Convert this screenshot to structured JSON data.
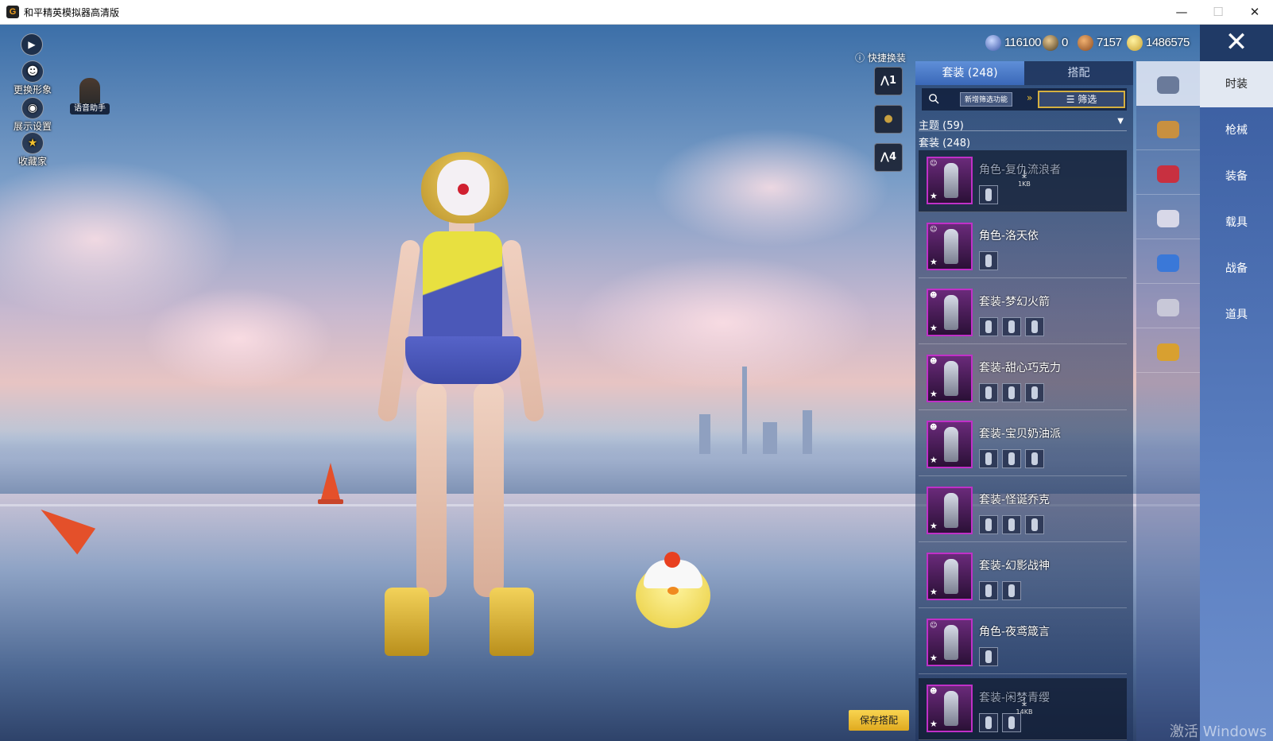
{
  "window": {
    "title": "和平精英模拟器高清版",
    "app_icon_letter": "G",
    "minimize": "—",
    "maximize": "☐",
    "close": "✕"
  },
  "left_toolbar": {
    "change_avatar": "更换形象",
    "display_settings": "展示设置",
    "collector": "收藏家",
    "voice_assistant": "语音助手"
  },
  "currencies": [
    {
      "icon": "blue-coin-icon",
      "value": "116100"
    },
    {
      "icon": "token-icon",
      "value": "0"
    },
    {
      "icon": "bronze-coin-icon",
      "value": "7157"
    },
    {
      "icon": "gold-coin-icon",
      "value": "1486575"
    }
  ],
  "quick_change": {
    "label": "快捷换装",
    "slots": [
      "1",
      "",
      "4"
    ]
  },
  "panel": {
    "tabs": {
      "suits": "套装 (248)",
      "match": "搭配"
    },
    "new_filter": "新增筛选功能",
    "filter": "筛选",
    "theme": "主题 (59)",
    "suits_count": "套装 (248)",
    "items": [
      {
        "name": "角色-复仇流浪者",
        "parts": 1,
        "dim": true,
        "download": "1KB",
        "badge": "role"
      },
      {
        "name": "角色-洛天依",
        "parts": 1,
        "dim": false,
        "download": "",
        "badge": "role"
      },
      {
        "name": "套装-梦幻火箭",
        "parts": 3,
        "dim": false,
        "download": "",
        "badge": "suit"
      },
      {
        "name": "套装-甜心巧克力",
        "parts": 3,
        "dim": false,
        "download": "",
        "badge": "suit"
      },
      {
        "name": "套装-宝贝奶油派",
        "parts": 3,
        "dim": false,
        "download": "",
        "badge": "suit"
      },
      {
        "name": "套装-怪诞乔克",
        "parts": 3,
        "dim": false,
        "download": "",
        "badge": ""
      },
      {
        "name": "套装-幻影战神",
        "parts": 2,
        "dim": false,
        "download": "",
        "badge": ""
      },
      {
        "name": "角色-夜鸢箴言",
        "parts": 1,
        "dim": false,
        "download": "",
        "badge": "role"
      },
      {
        "name": "套装-闲梦青缨",
        "parts": 2,
        "dim": true,
        "download": "14KB",
        "badge": "suit"
      }
    ]
  },
  "category_icons": [
    {
      "name": "hat-icon",
      "color": "#6a7a9a"
    },
    {
      "name": "backpack-icon",
      "color": "#c89040"
    },
    {
      "name": "lips-icon",
      "color": "#c83040"
    },
    {
      "name": "clown-mask-icon",
      "color": "#d8d8e8"
    },
    {
      "name": "outfit-icon",
      "color": "#3a78d8"
    },
    {
      "name": "pants-icon",
      "color": "#c8c8d8"
    },
    {
      "name": "shoes-icon",
      "color": "#d8a030"
    }
  ],
  "category_tabs": [
    "时装",
    "枪械",
    "装备",
    "载具",
    "战备",
    "道具"
  ],
  "save_button": "保存搭配",
  "watermark": "激活 Windows",
  "exit": "✕"
}
